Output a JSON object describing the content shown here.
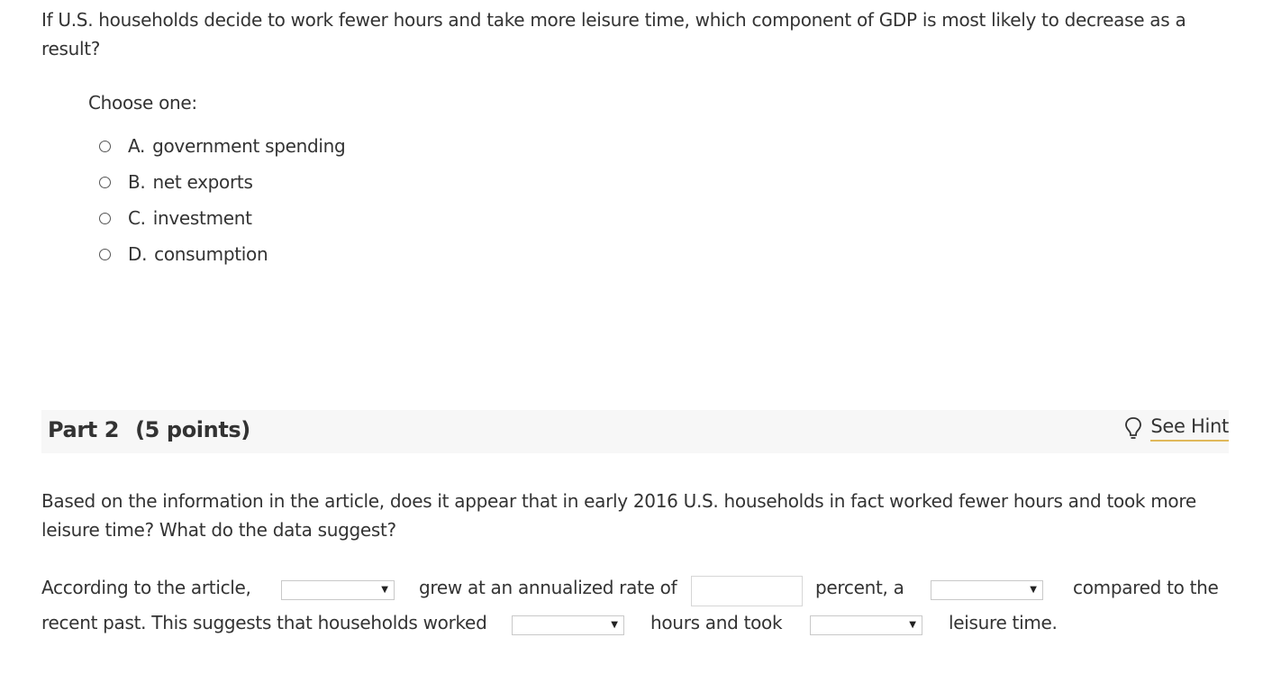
{
  "question1": {
    "text": "If U.S. households decide to work fewer hours and take more leisure time, which component of GDP is most likely to decrease as a result?",
    "choose_label": "Choose one:",
    "options": [
      {
        "letter": "A.",
        "label": "government spending"
      },
      {
        "letter": "B.",
        "label": "net exports"
      },
      {
        "letter": "C.",
        "label": "investment"
      },
      {
        "letter": "D.",
        "label": "consumption"
      }
    ]
  },
  "part2": {
    "title": "Part 2",
    "points": "(5 points)",
    "hint_label": "See Hint",
    "question": "Based on the information in the article, does it appear that in early 2016 U.S. households in fact worked fewer hours and took more leisure time? What do the data suggest?",
    "fill": {
      "t1": "According to the article,",
      "t2": "grew at an annualized rate of",
      "t3": "percent, a",
      "t4": "compared to the",
      "t5": "recent past. This suggests that households worked",
      "t6": "hours and took",
      "t7": "leisure time.",
      "select_arrow": "▼",
      "select1_value": "",
      "select2_value": "",
      "select3_value": "",
      "select4_value": "",
      "rate_value": ""
    }
  }
}
